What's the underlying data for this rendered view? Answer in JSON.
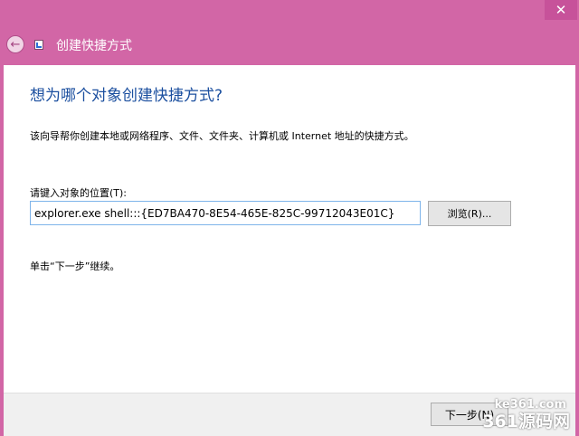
{
  "window": {
    "title": "创建快捷方式",
    "close_glyph": "✕",
    "back_glyph": "←"
  },
  "wizard": {
    "heading": "想为哪个对象创建快捷方式?",
    "description": "该向导帮你创建本地或网络程序、文件、文件夹、计算机或 Internet 地址的快捷方式。",
    "location_label": "请键入对象的位置(T):",
    "location_value": "explorer.exe shell:::{ED7BA470-8E54-465E-825C-99712043E01C}",
    "browse_label": "浏览(R)...",
    "hint": "单击“下一步”继续。",
    "next_label": "下一步(N)"
  },
  "watermark": {
    "site": "ke361.com",
    "brand": "361源码网"
  },
  "colors": {
    "window_frame": "#d266a6",
    "heading_blue": "#1b4f9f",
    "input_border": "#7eb4ea"
  }
}
